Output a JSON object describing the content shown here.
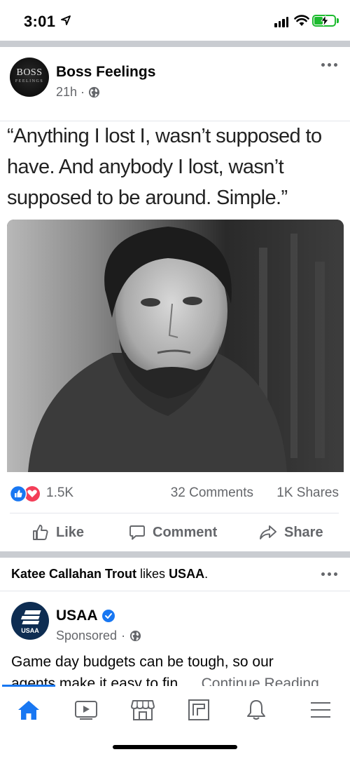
{
  "status_bar": {
    "time": "3:01"
  },
  "post": {
    "page_name": "Boss Feelings",
    "avatar_logo": "BOSS",
    "avatar_logo_sub": "FEELINGS",
    "time_ago": "21h",
    "separator": "·",
    "quote_line_1": "“Anything I lost I, wasn’t supposed to",
    "quote_line_2": "have. And anybody I lost, wasn’t",
    "quote_line_3": "supposed to be around. Simple.”",
    "reactions_count": "1.5K",
    "comments_count": "32 Comments",
    "shares_count": "1K Shares"
  },
  "actions": {
    "like": "Like",
    "comment": "Comment",
    "share": "Share"
  },
  "activity": {
    "friend_name": "Katee Callahan Trout",
    "verb": " likes ",
    "page": "USAA",
    "end": "."
  },
  "ad": {
    "name": "USAA",
    "avatar_text": "USAA",
    "sponsored": "Sponsored",
    "separator": "·",
    "text_line_1": "Game day budgets can be tough, so our",
    "text_line_2": "agents make it easy to fin...",
    "continue": "Continue Reading"
  },
  "colors": {
    "accent": "#1877f2",
    "secondary_text": "#65676b",
    "divider": "#c9ccd1",
    "like_blue": "#1877f2",
    "love_red": "#f33e58",
    "usaa_navy": "#0e2d52",
    "battery_green": "#1dbb2f"
  },
  "tabs": [
    "home-icon",
    "watch-icon",
    "marketplace-icon",
    "pages-icon",
    "notifications-icon",
    "menu-icon"
  ],
  "active_tab": "home-icon"
}
